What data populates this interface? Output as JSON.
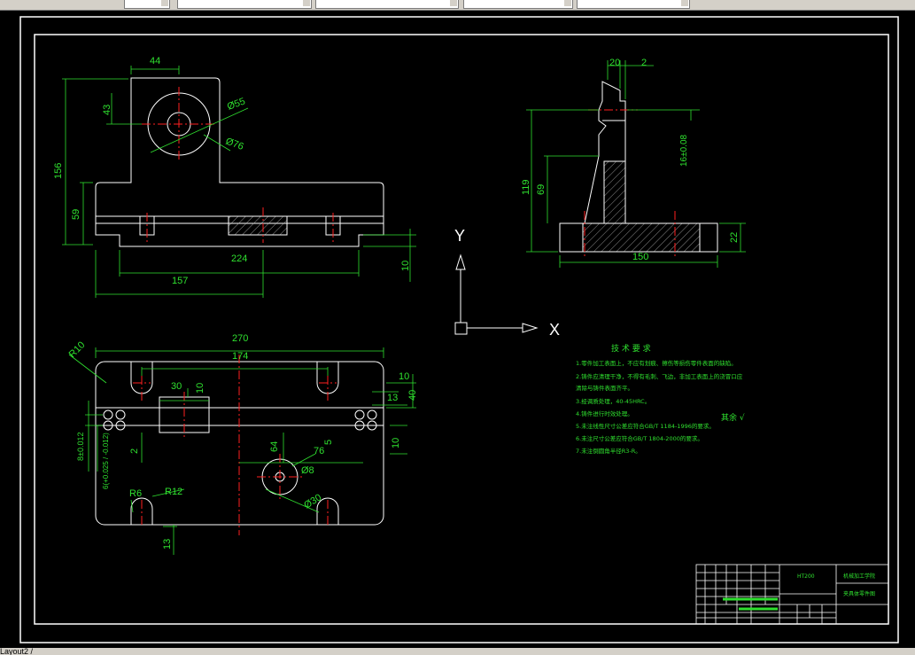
{
  "toolbar": {
    "boxes": [
      "",
      "",
      "",
      "",
      ""
    ]
  },
  "status": {
    "layout_tab": "Layout2 /"
  },
  "dimensions": {
    "front": {
      "d44": "44",
      "d43": "43",
      "d156": "156",
      "d59": "59",
      "dia55": "Ø55",
      "dia76": "Ø76",
      "d224": "224",
      "d157": "157",
      "d10": "10"
    },
    "side": {
      "d20": "20",
      "d2": "2",
      "d119": "119",
      "d69": "69",
      "tol": "16±0.08",
      "d22": "22",
      "d150": "150"
    },
    "plan": {
      "r10": "R10",
      "d270": "270",
      "d174": "174",
      "d30": "30",
      "d10a": "10",
      "d10b": "10",
      "d40": "40",
      "d13": "13",
      "d5": "5",
      "d76": "76",
      "d10c": "10",
      "d64": "64",
      "dia8": "Ø8",
      "dia30": "Ø30",
      "r6": "R6",
      "r12": "R12",
      "d13b": "13",
      "d2": "2",
      "fit1": "8±0.012",
      "fit2": "6(+0.025 / -0.012)"
    }
  },
  "ucs": {
    "x": "X",
    "y": "Y"
  },
  "tech_requirements": {
    "title": "技 术 要 求",
    "lines": [
      "1.零件加工表面上，不应有划痕、擦伤等损伤零件表面的缺陷。",
      "2.铸件应清理干净，不得有毛刺、飞边，非加工表面上的浇冒口应",
      "清除与铸件表面齐平。",
      "3.经调质处理，40-45HRC。",
      "4.铸件进行时效处理。",
      "5.未注线性尺寸公差应符合GB/T 1184-1996的要求。",
      "6.未注尺寸公差应符合GB/T 1804-2000的要求。",
      "7.未注倒圆角半径R3-R。"
    ],
    "roughness": "其余 √"
  },
  "title_block": {
    "material": "HT200",
    "school": "机械加工学院",
    "drawing_name": "夹具体零件图"
  },
  "colors": {
    "dim": "#2fe02f",
    "outline": "#ffffff",
    "center": "#ff2020",
    "hatch": "#cccccc"
  }
}
